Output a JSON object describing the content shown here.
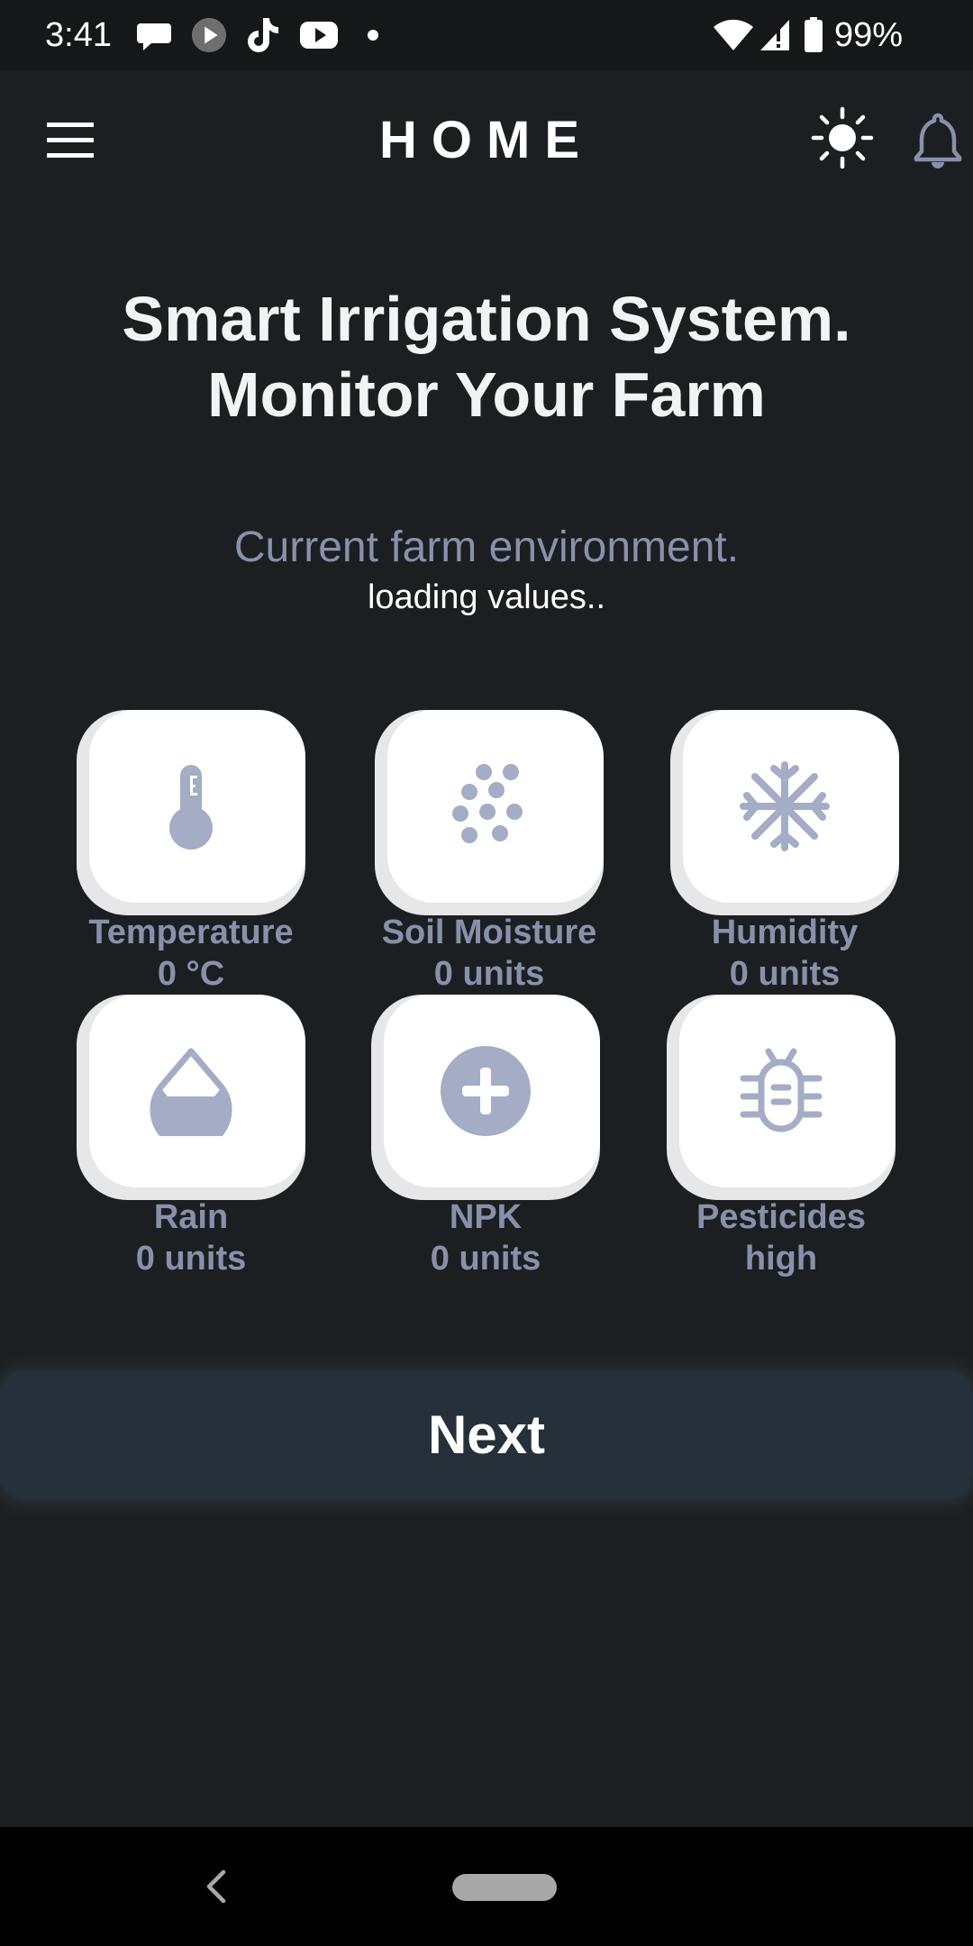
{
  "status_bar": {
    "time": "3:41",
    "battery": "99%",
    "icons": [
      "messages-icon",
      "play-icon",
      "tiktok-icon",
      "youtube-icon",
      "dot-icon",
      "wifi-icon",
      "signal-icon",
      "battery-icon"
    ]
  },
  "header": {
    "title": "HOME",
    "icons": [
      "menu-icon",
      "sun-icon",
      "bell-icon"
    ]
  },
  "hero": {
    "headline_line1": "Smart Irrigation System.",
    "headline_line2": "Monitor Your Farm",
    "subhead": "Current farm environment.",
    "loading": "loading values.."
  },
  "sensors": [
    {
      "label": "Temperature",
      "value": "0 °C",
      "icon": "thermometer-icon"
    },
    {
      "label": "Soil Moisture",
      "value": "0 units",
      "icon": "soil-dots-icon"
    },
    {
      "label": "Humidity",
      "value": "0 units",
      "icon": "snowflake-icon"
    },
    {
      "label": "Rain",
      "value": "0 units",
      "icon": "water-drop-icon"
    },
    {
      "label": "NPK",
      "value": "0 units",
      "icon": "plus-circle-icon"
    },
    {
      "label": "Pesticides",
      "value": "high",
      "icon": "bug-icon"
    }
  ],
  "actions": {
    "next_label": "Next"
  },
  "colors": {
    "background": "#1c1f21",
    "accent_text": "#8a90ab",
    "icon_fill": "#a5acc5",
    "tile": "#ffffff",
    "button": "#25303a"
  }
}
